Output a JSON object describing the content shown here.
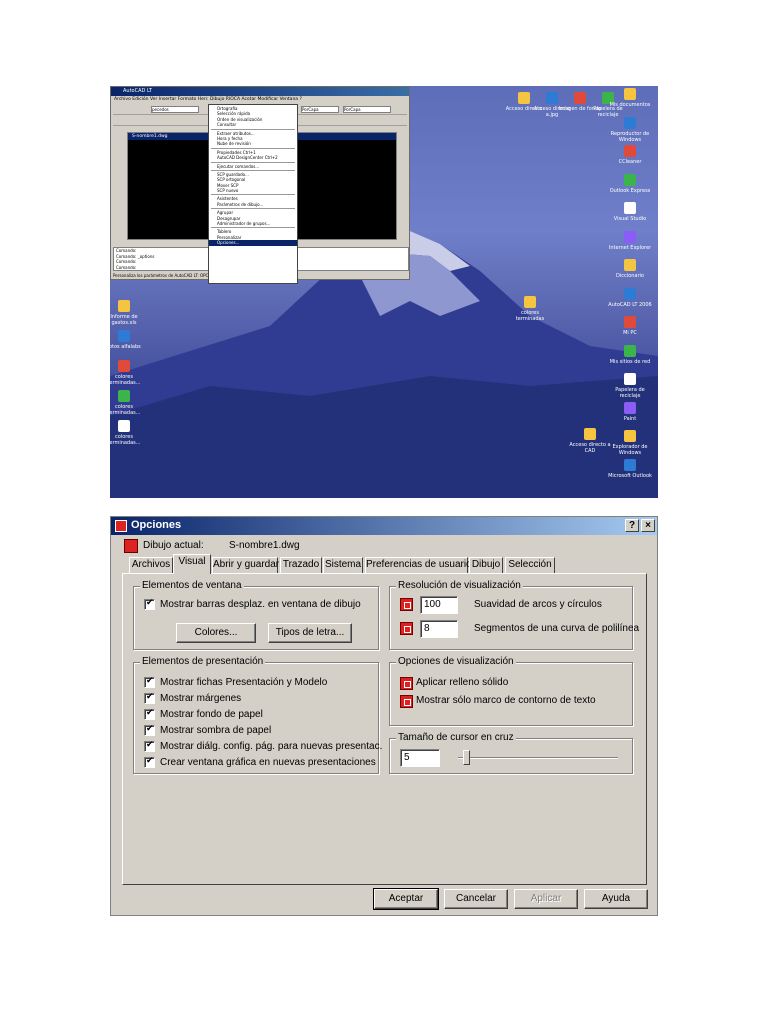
{
  "desktop": {
    "autocad_title": "AutoCAD LT",
    "menubar": "Archivo  Edición  Ver  Insertar  Formato  Herr.  Dibujo  RIOCA  Acotar  Modificar  Ventana  ?",
    "layer_value": "pecedos",
    "layer_combo_2": "PorCapa",
    "layer_combo_3": "PorCapa",
    "drawing_title": "S-nombre1.dwg",
    "command_lines": [
      "Comando:",
      "Comando: _options",
      "Comando:",
      "Comando:"
    ],
    "status_text": "Personaliza los parámetros de AutoCAD LT:  OPCIONES",
    "menu_items": [
      "Ortografía",
      "Selección rápida",
      "Orden de visualización",
      "Consultar",
      "",
      "Extraer atributos...",
      "Hora y fecha",
      "Nube de revisión",
      "",
      "Propiedades            Ctrl+1",
      "AutoCAD DesignCenter  Ctrl+2",
      "",
      "Ejecutar comandos...",
      "",
      "SCP guardado...",
      "SCP ortogonal",
      "Mover SCP",
      "SCP nuevo",
      "",
      "Asistentes",
      "Parámetros de dibujo...",
      "",
      "Agrupar",
      "Desagrupar",
      "Administrador de grupos...",
      "",
      "Tablero",
      "Personalizar",
      "Opciones..."
    ],
    "icons_left": [
      "Informe de gastos.xls",
      "fotos alfalabs",
      "colores terminadas...",
      "colores terminadas...",
      "colores terminadas..."
    ],
    "icons_mid": [
      "colores terminadas"
    ],
    "icons_top": [
      "Acceso directo",
      "Acceso directo a.jpg",
      "Imagen de fondo",
      "Papelera de reciclaje"
    ],
    "icons_right": [
      "Mis documentos",
      "Reproductor de Windows",
      "CCleaner",
      "Outlook Express",
      "Visual Studio",
      "Internet Explorer",
      "Diccionario",
      "AutoCAD LT 2006",
      "Mi PC",
      "Mis sitios de red",
      "Papelera de reciclaje",
      "Paint",
      "Explorador de Windows",
      "Microsoft Outlook"
    ],
    "icons_bottom": [
      "Acceso directo a CAD"
    ]
  },
  "dialog": {
    "title": "Opciones",
    "help_button": "?",
    "close_button": "×",
    "drawing_label": "Dibujo actual:",
    "drawing_name": "S-nombre1.dwg",
    "tabs": [
      "Archivos",
      "Visual",
      "Abrir y guardar",
      "Trazado",
      "Sistema",
      "Preferencias de usuario",
      "Dibujo",
      "Selección"
    ],
    "active_tab": "Visual",
    "window_elements": {
      "label": "Elementos de ventana",
      "checkbox": "Mostrar barras desplaz. en ventana de dibujo",
      "colors_button": "Colores...",
      "fonts_button": "Tipos de letra..."
    },
    "presentation_elements": {
      "label": "Elementos de presentación",
      "items": [
        "Mostrar fichas Presentación y Modelo",
        "Mostrar márgenes",
        "Mostrar fondo de papel",
        "Mostrar sombra de papel",
        "Mostrar diálg. config. pág. para nuevas presentac.",
        "Crear ventana gráfica en nuevas presentaciones"
      ]
    },
    "display_resolution": {
      "label": "Resolución de visualización",
      "arc_value": "100",
      "arc_label": "Suavidad de arcos y círculos",
      "seg_value": "8",
      "seg_label": "Segmentos de una curva de polilínea"
    },
    "display_options": {
      "label": "Opciones de visualización",
      "fill": "Aplicar relleno sólido",
      "text_frame": "Mostrar sólo marco de contorno de texto"
    },
    "crosshair": {
      "label": "Tamaño de cursor en cruz",
      "value": "5",
      "slider_fraction": 0.05
    },
    "buttons": {
      "ok": "Aceptar",
      "cancel": "Cancelar",
      "apply": "Aplicar",
      "help": "Ayuda"
    }
  }
}
